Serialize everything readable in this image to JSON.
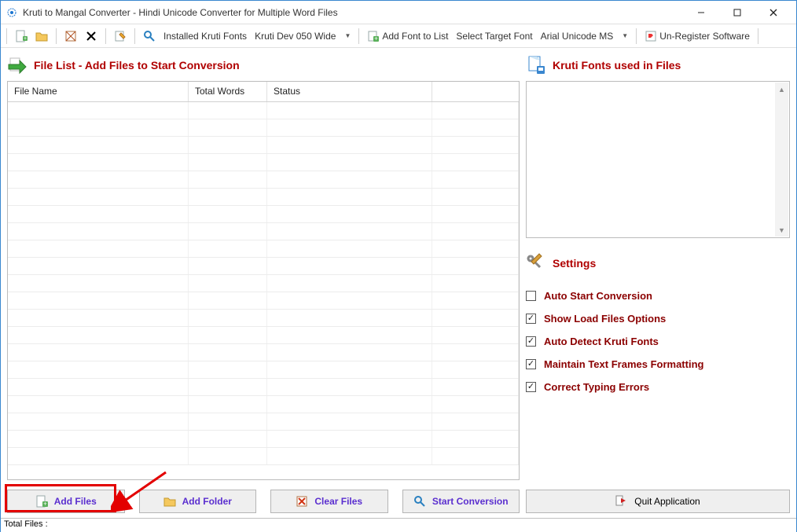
{
  "title": "Kruti to Mangal Converter - Hindi Unicode Converter for Multiple Word Files",
  "toolbar": {
    "installed_label": "Installed Kruti Fonts",
    "installed_value": "Kruti Dev 050 Wide",
    "addfont_label": "Add Font to List",
    "target_label": "Select Target Font",
    "target_value": "Arial Unicode MS",
    "unregister_label": "Un-Register Software"
  },
  "file_list": {
    "header": "File List - Add Files to Start Conversion",
    "columns": {
      "name": "File Name",
      "words": "Total Words",
      "status": "Status"
    }
  },
  "buttons": {
    "add_files": "Add Files",
    "add_folder": "Add Folder",
    "clear_files": "Clear Files",
    "start": "Start Conversion",
    "quit": "Quit Application"
  },
  "right_panel": {
    "fonts_header": "Kruti Fonts used in Files",
    "settings_header": "Settings",
    "settings": [
      {
        "label": "Auto Start Conversion",
        "checked": false
      },
      {
        "label": "Show Load Files Options",
        "checked": true
      },
      {
        "label": "Auto Detect Kruti Fonts",
        "checked": true
      },
      {
        "label": "Maintain Text Frames Formatting",
        "checked": true
      },
      {
        "label": "Correct Typing Errors",
        "checked": true
      }
    ]
  },
  "status": {
    "total_files": "Total Files :"
  }
}
